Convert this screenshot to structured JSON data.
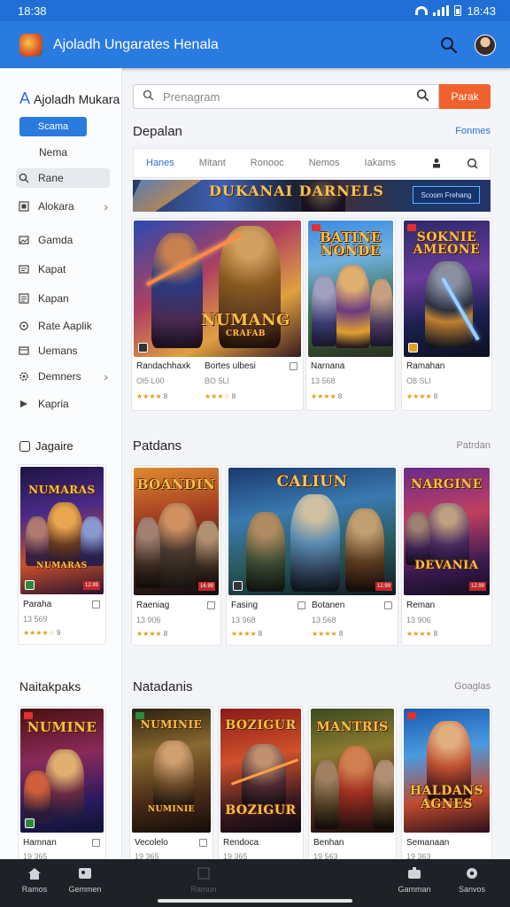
{
  "status_bar": {
    "time": "18:38",
    "right_time": "18:43"
  },
  "app_bar": {
    "title": "Ajoladh Ungarates Henala"
  },
  "sidebar": {
    "header_letter": "A",
    "header": "Ajoladh Mukara",
    "pill": "Scama",
    "plain": "Nema",
    "items": [
      {
        "label": "Rane",
        "icon": "search-icon",
        "active": true
      },
      {
        "label": "Alokara",
        "icon": "grid-icon",
        "chevron": true
      },
      {
        "label": "Gamda",
        "icon": "image-icon"
      },
      {
        "label": "Kapat",
        "icon": "folder-icon"
      },
      {
        "label": "Kapan",
        "icon": "list-icon"
      },
      {
        "label": "Rate Aaplik",
        "icon": "refresh-icon"
      },
      {
        "label": "Uemans",
        "icon": "box-icon"
      },
      {
        "label": "Demners",
        "icon": "settings-icon",
        "chevron": true
      },
      {
        "label": "Kapria",
        "icon": "play-icon"
      }
    ],
    "section_head": "Jagaire",
    "section_head2": "Naitakpaks",
    "side_cards": [
      {
        "title": "NUMARAS",
        "name": "Paraha",
        "meta": "13 569",
        "stars": "★★★★☆",
        "count": "9",
        "tag": "12.99"
      },
      {
        "title": "NUMINE",
        "name": "Hamnan",
        "meta": "19 365",
        "stars": "",
        "count": "",
        "tag": ""
      }
    ]
  },
  "search": {
    "placeholder": "Prenagram",
    "button": "Parak"
  },
  "sections": {
    "s1": {
      "title": "Depalan",
      "link": "Fonmes"
    },
    "s2": {
      "title": "Patdans",
      "link": "Patrdan"
    },
    "s3": {
      "title": "Natadanis",
      "link": "Goaglas"
    }
  },
  "tabs": [
    "Hanes",
    "Mitant",
    "Ronooc",
    "Nemos",
    "Iakams"
  ],
  "banner": {
    "title": "DUKANAI DARNELS",
    "button": "Scoom Frehang"
  },
  "row1": [
    {
      "title": "NUMANG",
      "subtitle": "CRAFAB",
      "name": "Randachhaxk",
      "name2": "Bortes ulbesi",
      "meta": "Ol5 L00",
      "meta2": "BO 5LI",
      "stars": "★★★★",
      "count": "8",
      "stars2": "★★★☆",
      "count2": "8"
    },
    {
      "title": "BATINE NONDE",
      "name": "Narnana",
      "meta": "13 568",
      "stars": "★★★★",
      "count": "8"
    },
    {
      "title": "SOKNIE AMEONE",
      "name": "Ramahan",
      "meta": "O8 SLI",
      "stars": "★★★★",
      "count": "8"
    }
  ],
  "row2": [
    {
      "title": "BOANDIN",
      "name": "Raeniag",
      "meta": "13 906",
      "stars": "★★★★",
      "count": "8",
      "tag": "16.99"
    },
    {
      "title": "CALIUN",
      "name": "Fasing",
      "meta": "13 968",
      "stars": "★★★★",
      "count": "8",
      "tag": "12.99"
    },
    {
      "title": "DEVANIA",
      "name": "Botanen",
      "meta": "13 568",
      "stars": "★★★★",
      "count": "8",
      "tag": "12.99"
    },
    {
      "title": "NARGINE",
      "name": "Reman",
      "meta": "13 906",
      "stars": "★★★★",
      "count": "8",
      "tag": "12.99"
    }
  ],
  "row3": [
    {
      "title": "NUMINIE",
      "name": "Vecolelo",
      "meta": "19 365"
    },
    {
      "title": "BOZIGUR",
      "name": "Rendoca",
      "meta": "19 365"
    },
    {
      "title": "MANTRIS",
      "name": "Benhan",
      "meta": "19 563"
    },
    {
      "title": "HALDANS AGNES",
      "name": "Semanaan",
      "meta": "19 363"
    }
  ],
  "bottom_nav": [
    "Ramos",
    "Gemmen",
    "Ramun",
    "Gamman",
    "Sanvos"
  ],
  "colors": {
    "app_bar": "#2a7be0",
    "search_button": "#f0622d",
    "bottom_nav": "#1e2125"
  }
}
